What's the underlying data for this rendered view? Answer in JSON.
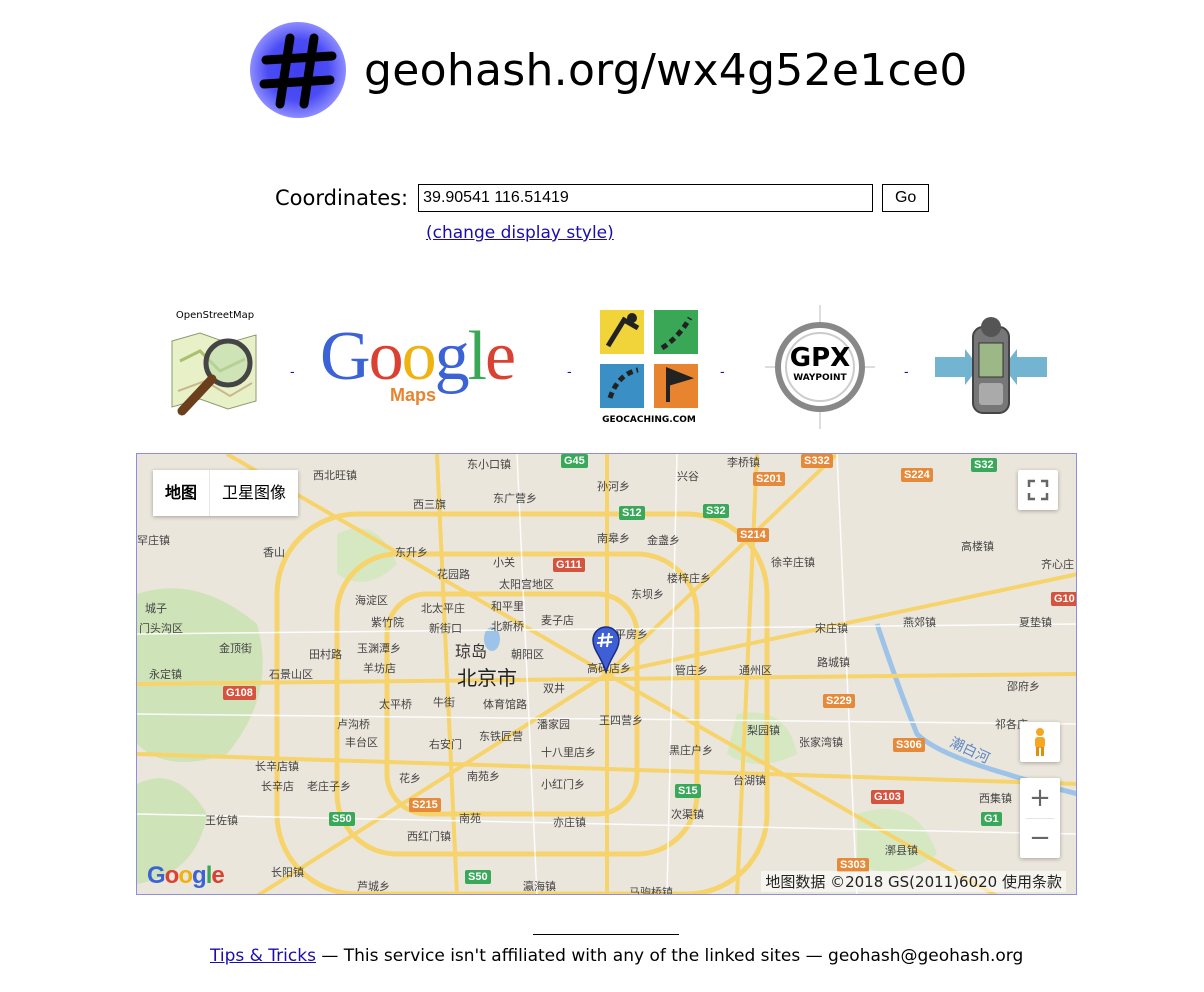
{
  "header": {
    "title": "geohash.org/wx4g52e1ce0",
    "logo_icon": "hash-logo-icon"
  },
  "form": {
    "label": "Coordinates:",
    "input_value": "39.90541 116.51419",
    "go_label": "Go",
    "style_link": "(change display style)"
  },
  "services": {
    "items": [
      {
        "name": "openstreetmap",
        "caption": "OpenStreetMap"
      },
      {
        "name": "google-maps",
        "word": "Google",
        "sub": "Maps"
      },
      {
        "name": "geocaching",
        "caption": "GEOCACHING.COM"
      },
      {
        "name": "gpx-waypoint",
        "line1": "GPX",
        "line2": "WAYPOINT"
      },
      {
        "name": "gps-device"
      }
    ],
    "separator": "-"
  },
  "map": {
    "type_map": "地图",
    "type_satellite": "卫星图像",
    "attribution": "地图数据 ©2018 GS(2011)6020   使用条款",
    "watermark": "Google",
    "zoom_in": "+",
    "zoom_out": "−",
    "city_label": "北京市",
    "district_label": "琼岛",
    "labels": [
      "西北旺镇",
      "东小口镇",
      "西三旗",
      "东广营乡",
      "孙河乡",
      "兴谷",
      "李桥镇",
      "罕庄镇",
      "香山",
      "东升乡",
      "小关",
      "太阳宫地区",
      "南皋乡",
      "金盏乡",
      "徐辛庄镇",
      "高楼镇",
      "城子",
      "门头沟区",
      "海淀区",
      "北太平庄",
      "和平里",
      "楼梓庄乡",
      "宋庄镇",
      "燕郊镇",
      "金顶街",
      "紫竹院",
      "新街口",
      "北新桥",
      "麦子店",
      "东坝乡",
      "夏垫镇",
      "永定镇",
      "田村路",
      "玉渊潭乡",
      "朝阳区",
      "平房乡",
      "路城镇",
      "石景山区",
      "羊坊店",
      "高碑店乡",
      "管庄乡",
      "通州区",
      "邵府乡",
      "太平桥",
      "牛街",
      "体育馆路",
      "双井",
      "王四营乡",
      "卢沟桥",
      "丰台区",
      "右安门",
      "东铁匠营",
      "潘家园",
      "十八里店乡",
      "黑庄户乡",
      "梨园镇",
      "张家湾镇",
      "长辛店镇",
      "花乡",
      "南苑乡",
      "小红门乡",
      "台湖镇",
      "西集镇",
      "长辛店",
      "老庄子乡",
      "王佐镇",
      "南苑",
      "亦庄镇",
      "次渠镇",
      "西红门镇",
      "长阳镇",
      "芦城乡",
      "瀛海镇",
      "马驹桥镇",
      "漷县镇",
      "潮白河",
      "花园路",
      "祁各庄",
      "齐心庄"
    ],
    "shields": [
      "G45",
      "S12",
      "S32",
      "G111",
      "S201",
      "S224",
      "S32",
      "S214",
      "G10",
      "G108",
      "S229",
      "S306",
      "S15",
      "G103",
      "S215",
      "S50",
      "G1",
      "S303",
      "S50",
      "S332"
    ]
  },
  "footer": {
    "tips_link": "Tips & Tricks",
    "text": " — This service isn't affiliated with any of the linked sites — geohash@geohash.org"
  }
}
